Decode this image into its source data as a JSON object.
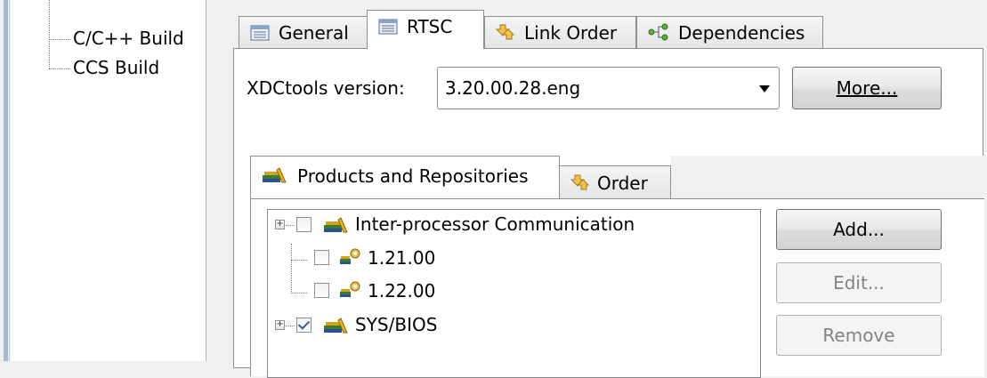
{
  "nav": {
    "items": [
      {
        "label": "C/C++ Build"
      },
      {
        "label": "CCS Build"
      }
    ]
  },
  "tabs": [
    {
      "label": "General",
      "icon": "page-icon"
    },
    {
      "label": "RTSC",
      "icon": "page-icon"
    },
    {
      "label": "Link Order",
      "icon": "link-order-icon"
    },
    {
      "label": "Dependencies",
      "icon": "dependencies-icon"
    }
  ],
  "rtsc": {
    "xdc_label": "XDCtools version:",
    "xdc_value": "3.20.00.28.eng",
    "more_button": "More...",
    "inner_tabs": [
      {
        "label": "Products and Repositories",
        "icon": "books-icon"
      },
      {
        "label": "Order",
        "icon": "order-icon"
      }
    ],
    "tree": [
      {
        "label": "Inter-processor Communication",
        "checked": false,
        "icon": "books-icon",
        "expander": "+"
      },
      {
        "label": "1.21.00",
        "checked": false,
        "icon": "package-icon"
      },
      {
        "label": "1.22.00",
        "checked": false,
        "icon": "package-icon"
      },
      {
        "label": "SYS/BIOS",
        "checked": true,
        "icon": "books-icon",
        "expander": "+"
      }
    ],
    "buttons": {
      "add": "Add...",
      "edit": "Edit...",
      "remove": "Remove"
    }
  }
}
